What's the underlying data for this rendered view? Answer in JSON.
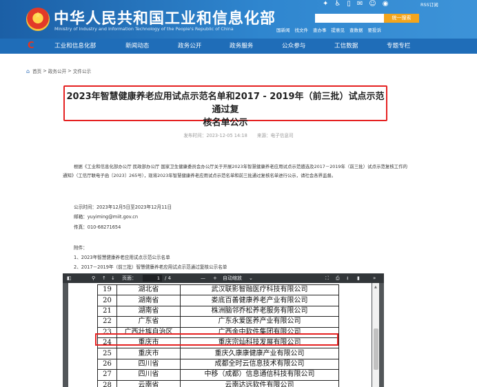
{
  "header": {
    "site_title": "中华人民共和国工业和信息化部",
    "site_subtitle": "Ministry of Industry and Information Technology of the People's Republic of China",
    "rss": "RSS订阅",
    "search_button": "统一搜索",
    "quick_links": [
      "国新闻",
      "找文件",
      "查办事",
      "提意见",
      "查数据",
      "要投诉"
    ]
  },
  "nav": {
    "items": [
      "工业和信息化部",
      "新闻动态",
      "政务公开",
      "政务服务",
      "公众参与",
      "工信数据",
      "专题专栏"
    ]
  },
  "breadcrumb": [
    "首页",
    "政务公开",
    "文件公示"
  ],
  "article": {
    "title_line1": "2023年智慧健康养老应用试点示范名单和2017 - 2019年（前三批）试点示范通过复",
    "title_line2": "核名单公示",
    "pub_time": "发布时间：2023-12-05 14:18",
    "source": "来源：电子信息司",
    "paragraph": "根据《工业和信息化部办公厅 民政部办公厅 国家卫生健康委员会办公厅关于开展2023年智慧健康养老应用试点示范遴选及2017－2019年（前三批）试点示范复核工作的通知》（工信厅联电子函〔2023〕265号），现将2023年智慧健康养老应用试点示范名单和前三批通过复核名单进行公示，请社会各界监督。",
    "notice_period": "公示时间：2023年12月5日至2023年12月11日",
    "email": "邮箱：yuyiming@miit.gov.cn",
    "fax": "传真：010-68271654",
    "attachments_label": "附件：",
    "attachments": [
      "1、2023年智慧健康养老应用试点示范公示名单",
      "2、2017－2019年（前三批）智慧健康养老应用试点示范通过复核公示名单"
    ]
  },
  "viewer": {
    "page_label": "页面：",
    "page_current": "1",
    "page_total": "/ 4",
    "zoom_minus": "—",
    "zoom_plus": "+",
    "zoom_mode": "自动缩放",
    "rows": [
      {
        "no": "19",
        "province": "湖北省",
        "company": "武汉联影智融医疗科技有限公司"
      },
      {
        "no": "20",
        "province": "湖南省",
        "company": "娄底百善健康养老产业有限公司"
      },
      {
        "no": "21",
        "province": "湖南省",
        "company": "株洲脑邻乔松养老服务有限公司"
      },
      {
        "no": "22",
        "province": "广东省",
        "company": "广东永爱医养产业有限公司"
      },
      {
        "no": "23",
        "province": "广西壮族自治区",
        "company": "广西金中软件集团有限公司"
      },
      {
        "no": "24",
        "province": "重庆市",
        "company": "重庆宗灿科技发展有限公司"
      },
      {
        "no": "25",
        "province": "重庆市",
        "company": "重庆久康康健康产业有限公司"
      },
      {
        "no": "26",
        "province": "四川省",
        "company": "成都全时云信息技术有限公司"
      },
      {
        "no": "27",
        "province": "四川省",
        "company": "中移（成都）信息通信科技有限公司"
      },
      {
        "no": "28",
        "province": "云南省",
        "company": "云南达远软件有限公司"
      }
    ]
  }
}
